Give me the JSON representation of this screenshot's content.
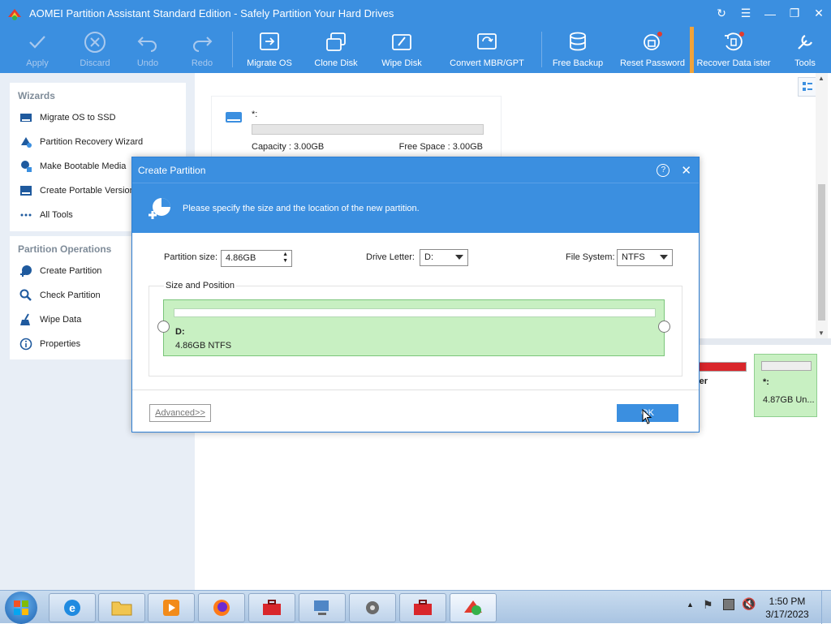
{
  "window": {
    "title": "AOMEI Partition Assistant Standard Edition - Safely Partition Your Hard Drives"
  },
  "toolbar": {
    "apply": "Apply",
    "discard": "Discard",
    "undo": "Undo",
    "redo": "Redo",
    "migrate_os": "Migrate OS",
    "clone_disk": "Clone Disk",
    "wipe_disk": "Wipe Disk",
    "convert_mbr_gpt": "Convert MBR/GPT",
    "free_backup": "Free Backup",
    "reset_password": "Reset Password",
    "recover_data": "Recover Data ister",
    "tools": "Tools"
  },
  "sidebar": {
    "wizards_title": "Wizards",
    "wizards": [
      {
        "label": "Migrate OS to SSD",
        "icon": "ssd-icon"
      },
      {
        "label": "Partition Recovery Wizard",
        "icon": "recovery-icon"
      },
      {
        "label": "Make Bootable Media",
        "icon": "bootable-media-icon"
      },
      {
        "label": "Create Portable Version",
        "icon": "portable-icon"
      },
      {
        "label": "All Tools",
        "icon": "dots-icon"
      }
    ],
    "operations_title": "Partition Operations",
    "operations": [
      {
        "label": "Create Partition",
        "icon": "create-partition-icon"
      },
      {
        "label": "Check Partition",
        "icon": "magnifier-icon"
      },
      {
        "label": "Wipe Data",
        "icon": "broom-icon"
      },
      {
        "label": "Properties",
        "icon": "info-icon"
      }
    ]
  },
  "disk_card": {
    "name": "*:",
    "capacity": "Capacity : 3.00GB",
    "free_space": "Free Space : 3.00GB"
  },
  "background_partitions": {
    "partial_label": "ter",
    "unalloc_name": "*:",
    "unalloc_size": "4.87GB Un..."
  },
  "dialog": {
    "title": "Create Partition",
    "banner_text": "Please specify the size and the location of the new partition.",
    "partition_size_label": "Partition size:",
    "partition_size_value": "4.86GB",
    "drive_letter_label": "Drive Letter:",
    "drive_letter_value": "D:",
    "file_system_label": "File System:",
    "file_system_value": "NTFS",
    "size_position_label": "Size and Position",
    "partition_letter": "D:",
    "partition_desc": "4.86GB NTFS",
    "advanced_button": "Advanced>>",
    "ok_button": "OK"
  },
  "taskbar": {
    "time": "1:50 PM",
    "date": "3/17/2023"
  },
  "colors": {
    "accent": "#3b8fe0",
    "partition_green": "#c8f0c2",
    "used_red": "#d9262b"
  }
}
